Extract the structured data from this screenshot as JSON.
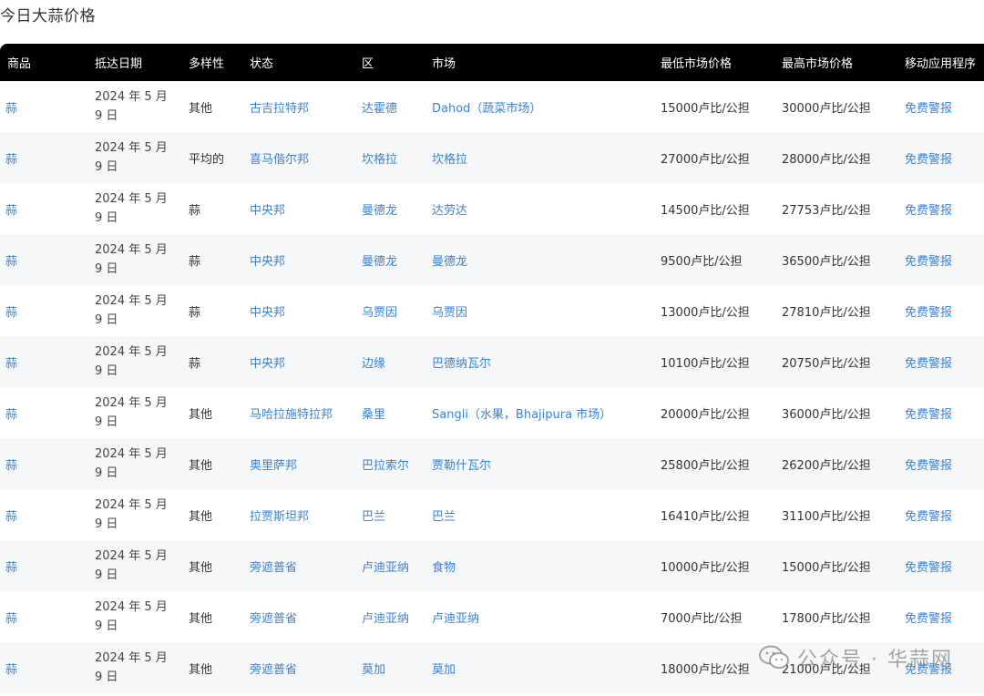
{
  "page_title": "今日大蒜价格",
  "columns": [
    "商品",
    "抵达日期",
    "多样性",
    "状态",
    "区",
    "市场",
    "最低市场价格",
    "最高市场价格",
    "移动应用程序"
  ],
  "rows": [
    {
      "commodity": "蒜",
      "date": "2024 年 5 月 9 日",
      "variety": "其他",
      "state": "古吉拉特邦",
      "district": "达霍德",
      "market": "Dahod（蔬菜市场）",
      "min_price": "15000卢比/公担",
      "max_price": "30000卢比/公担",
      "app": "免费警报"
    },
    {
      "commodity": "蒜",
      "date": "2024 年 5 月 9 日",
      "variety": "平均的",
      "state": "喜马偕尔邦",
      "district": "坎格拉",
      "market": "坎格拉",
      "min_price": "27000卢比/公担",
      "max_price": "28000卢比/公担",
      "app": "免费警报"
    },
    {
      "commodity": "蒜",
      "date": "2024 年 5 月 9 日",
      "variety": "蒜",
      "state": "中央邦",
      "district": "曼德龙",
      "market": "达劳达",
      "min_price": "14500卢比/公担",
      "max_price": "27753卢比/公担",
      "app": "免费警报"
    },
    {
      "commodity": "蒜",
      "date": "2024 年 5 月 9 日",
      "variety": "蒜",
      "state": "中央邦",
      "district": "曼德龙",
      "market": "曼德龙",
      "min_price": "9500卢比/公担",
      "max_price": "36500卢比/公担",
      "app": "免费警报"
    },
    {
      "commodity": "蒜",
      "date": "2024 年 5 月 9 日",
      "variety": "蒜",
      "state": "中央邦",
      "district": "乌贾因",
      "market": "乌贾因",
      "min_price": "13000卢比/公担",
      "max_price": "27810卢比/公担",
      "app": "免费警报"
    },
    {
      "commodity": "蒜",
      "date": "2024 年 5 月 9 日",
      "variety": "蒜",
      "state": "中央邦",
      "district": "边缘",
      "market": "巴德纳瓦尔",
      "min_price": "10100卢比/公担",
      "max_price": "20750卢比/公担",
      "app": "免费警报"
    },
    {
      "commodity": "蒜",
      "date": "2024 年 5 月 9 日",
      "variety": "其他",
      "state": "马哈拉施特拉邦",
      "district": "桑里",
      "market": "Sangli（水果，Bhajipura 市场）",
      "min_price": "20000卢比/公担",
      "max_price": "36000卢比/公担",
      "app": "免费警报"
    },
    {
      "commodity": "蒜",
      "date": "2024 年 5 月 9 日",
      "variety": "其他",
      "state": "奥里萨邦",
      "district": "巴拉索尔",
      "market": "贾勒什瓦尔",
      "min_price": "25800卢比/公担",
      "max_price": "26200卢比/公担",
      "app": "免费警报"
    },
    {
      "commodity": "蒜",
      "date": "2024 年 5 月 9 日",
      "variety": "其他",
      "state": "拉贾斯坦邦",
      "district": "巴兰",
      "market": "巴兰",
      "min_price": "16410卢比/公担",
      "max_price": "31100卢比/公担",
      "app": "免费警报"
    },
    {
      "commodity": "蒜",
      "date": "2024 年 5 月 9 日",
      "variety": "其他",
      "state": "旁遮普省",
      "district": "卢迪亚纳",
      "market": "食物",
      "min_price": "10000卢比/公担",
      "max_price": "15000卢比/公担",
      "app": "免费警报"
    },
    {
      "commodity": "蒜",
      "date": "2024 年 5 月 9 日",
      "variety": "其他",
      "state": "旁遮普省",
      "district": "卢迪亚纳",
      "market": "卢迪亚纳",
      "min_price": "7000卢比/公担",
      "max_price": "17800卢比/公担",
      "app": "免费警报"
    },
    {
      "commodity": "蒜",
      "date": "2024 年 5 月 9 日",
      "variety": "其他",
      "state": "旁遮普省",
      "district": "莫加",
      "market": "莫加",
      "min_price": "18000卢比/公担",
      "max_price": "21000卢比/公担",
      "app": "免费警报"
    }
  ],
  "date_lines": [
    "2024 年 5 月",
    "9 日"
  ],
  "watermark": "公众号 · 华蒜网",
  "colors": {
    "header_bg": "#000000",
    "link": "#3b82d6",
    "stripe": "#f6f7f9"
  }
}
